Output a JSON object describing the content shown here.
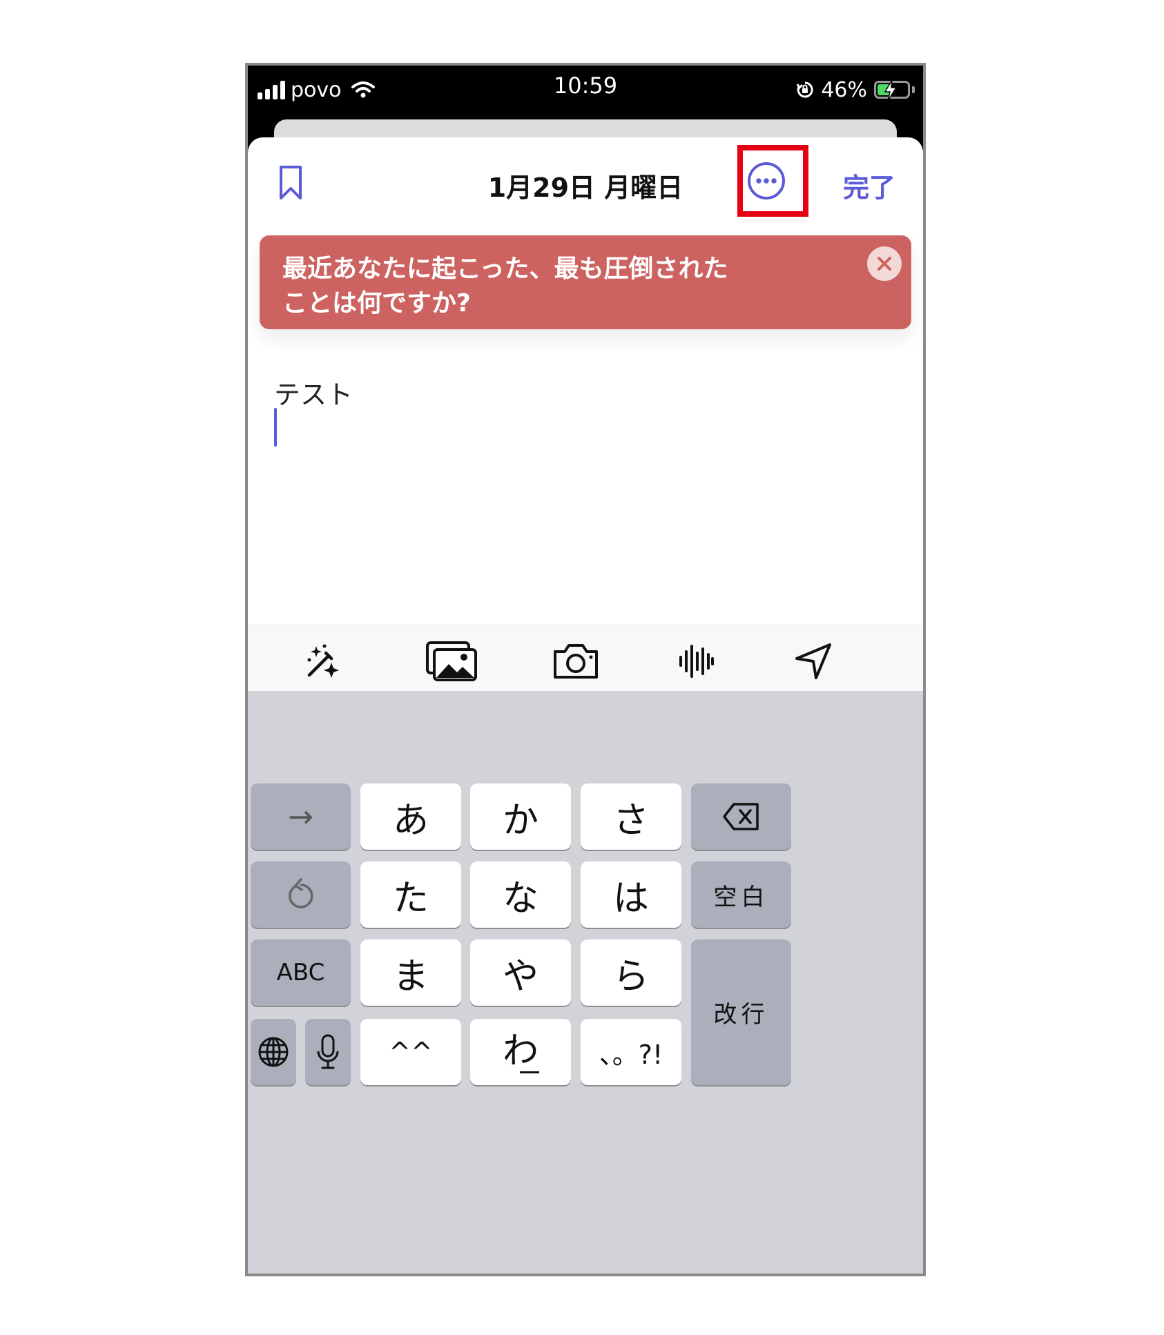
{
  "status_bar": {
    "carrier": "povo",
    "time": "10:59",
    "battery_percent": "46%",
    "battery_level": 0.46,
    "icons": [
      "signal-bars-icon",
      "wifi-icon",
      "rotation-lock-icon",
      "battery-charging-icon"
    ]
  },
  "navbar": {
    "title": "1月29日 月曜日",
    "done_label": "完了",
    "icons": [
      "bookmark-icon",
      "more-ellipsis-icon"
    ]
  },
  "prompt_card": {
    "line1": "最近あなたに起こった、最も圧倒された",
    "line2": "ことは何ですか?",
    "close_icon": "close-x-icon",
    "background": "#cd6360"
  },
  "editor": {
    "text": "テスト"
  },
  "toolbar": {
    "icons": [
      "magic-wand-icon",
      "photo-library-icon",
      "camera-icon",
      "audio-waveform-icon",
      "location-arrow-icon"
    ]
  },
  "keyboard": {
    "rows": [
      [
        "→",
        "あ",
        "か",
        "さ",
        "⌫"
      ],
      [
        "↺",
        "た",
        "な",
        "は",
        "空白"
      ],
      [
        "ABC",
        "ま",
        "や",
        "ら",
        "改行"
      ],
      [
        "🌐",
        "🎤",
        "^^",
        "わ",
        "、。?!"
      ]
    ],
    "labels": {
      "next": "→",
      "a": "あ",
      "ka": "か",
      "sa": "さ",
      "ta": "た",
      "na": "な",
      "ha": "は",
      "space": "空白",
      "abc": "ABC",
      "ma": "ま",
      "ya": "や",
      "ra": "ら",
      "enter": "改行",
      "emoticon": "^^",
      "wa": "わ",
      "punct": "、。?!"
    }
  },
  "colors": {
    "accent": "#5b5bd6",
    "highlight_box": "#e60012",
    "keyboard_bg": "#d1d3d9"
  }
}
